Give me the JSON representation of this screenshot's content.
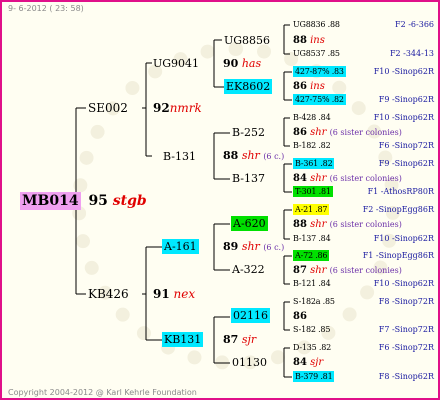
{
  "header": "9-  6-2012 ( 23: 58)",
  "footer": "Copyright 2004-2012 @ Karl Kehrle Foundation",
  "colors": {
    "border": "#e0108a",
    "magenta": "#f0a0f0",
    "cyan": "#00e8ff",
    "green": "#00e000",
    "yellow": "#ffff00",
    "suffix": "#e00000",
    "line": "#000000"
  },
  "root": {
    "name": "MB014",
    "num": "95",
    "sfx": "stgb"
  },
  "gen1": [
    {
      "name": "SE002",
      "num": "92",
      "sfx": "nmrk"
    },
    {
      "name": "KB426",
      "num": "91",
      "sfx": "nex"
    }
  ],
  "gen2": [
    {
      "name": "UG9041",
      "num": "90",
      "sfx": "has"
    },
    {
      "name": "B-131",
      "num": "88",
      "sfx": "shr",
      "note": "(6 c.)"
    },
    {
      "name": "A-161",
      "num": "89",
      "sfx": "shr",
      "note": "(6 c.)"
    },
    {
      "name": "KB131",
      "num": "87",
      "sfx": "sjr"
    }
  ],
  "gen3": [
    {
      "name": "UG8856"
    },
    {
      "name": "EK8602"
    },
    {
      "name": "B-252"
    },
    {
      "name": "B-137"
    },
    {
      "name": "A-620"
    },
    {
      "name": "A-322"
    },
    {
      "name": "02116"
    },
    {
      "name": "01130"
    }
  ],
  "gen4": [
    {
      "code": "UG8836 .88",
      "right": "F2 -6-366"
    },
    {
      "num": "88",
      "sfx": "ins"
    },
    {
      "code": "UG8537 .85",
      "right": "F2 -344-13"
    },
    {
      "code": "427-87% .83",
      "right": "F10 -Sinop62R"
    },
    {
      "num": "86",
      "sfx": "ins"
    },
    {
      "code": "427-75% .82",
      "right": "F9 -Sinop62R"
    },
    {
      "code": "B-428 .84",
      "right": "F10 -Sinop62R"
    },
    {
      "num": "86",
      "sfx": "shr",
      "note": "(6 sister colonies)"
    },
    {
      "code": "B-182 .82",
      "right": "F6 -Sinop72R"
    },
    {
      "code": "B-361 .82",
      "right": "F9 -Sinop62R"
    },
    {
      "num": "84",
      "sfx": "shr",
      "note": "(6 sister colonies)"
    },
    {
      "code": "T-301 .81",
      "right": "F1 -AthosRP80R"
    },
    {
      "code": "A-21 .87",
      "right": "F2 -SinopEgg86R"
    },
    {
      "num": "88",
      "sfx": "shr",
      "note": "(6 sister colonies)"
    },
    {
      "code": "B-137 .84",
      "right": "F10 -Sinop62R"
    },
    {
      "code": "A-72 .86",
      "right": "F1 -SinopEgg86R"
    },
    {
      "num": "87",
      "sfx": "shr",
      "note": "(6 sister colonies)"
    },
    {
      "code": "B-121 .84",
      "right": "F10 -Sinop62R"
    },
    {
      "code": "S-182a .85",
      "right": "F8 -Sinop72R"
    },
    {
      "num": "86",
      "sfx": ""
    },
    {
      "code": "S-182 .85",
      "right": "F7 -Sinop72R"
    },
    {
      "code": "D-135 .82",
      "right": "F6 -Sinop72R"
    },
    {
      "num": "84",
      "sfx": "sjr"
    },
    {
      "code": "B-379 .81",
      "right": "F8 -Sinop62R"
    }
  ]
}
